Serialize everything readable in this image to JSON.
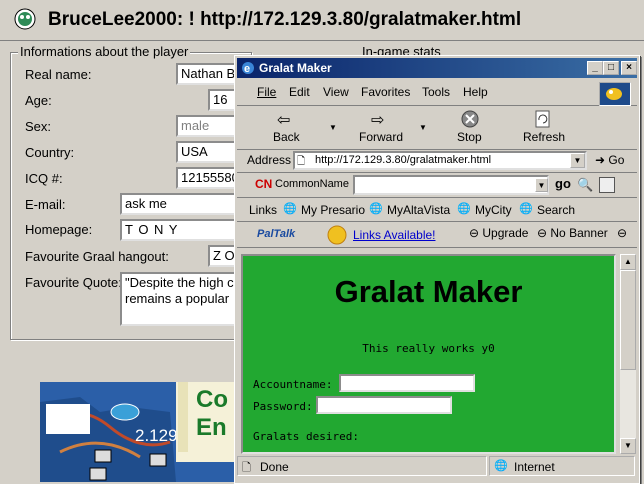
{
  "back_window": {
    "title": "BruceLee2000: ! http://172.129.3.80/gralatmaker.html",
    "group_title": "Informations about the player",
    "group2_title": "In-game stats",
    "fields": [
      {
        "label": "Real name:",
        "value": "Nathan B"
      },
      {
        "label": "Age:",
        "value": "16"
      },
      {
        "label": "Sex:",
        "value": "male"
      },
      {
        "label": "Country:",
        "value": "USA"
      },
      {
        "label": "ICQ #:",
        "value": "12155580"
      },
      {
        "label": "E-mail:",
        "value": "ask me"
      },
      {
        "label": "Homepage:",
        "value": "T O N Y"
      },
      {
        "label": "Favourite Graal hangout:",
        "value": "Z O"
      },
      {
        "label": "Favourite Quote:",
        "value": "\"Despite the high c\nremains a popular"
      }
    ],
    "map_overlay_text": "2.129",
    "ad_text": "Co\nEn"
  },
  "ie_window": {
    "title": "Gralat Maker",
    "menu": [
      "File",
      "Edit",
      "View",
      "Favorites",
      "Tools",
      "Help"
    ],
    "toolbar": {
      "back": "Back",
      "forward": "Forward",
      "stop": "Stop",
      "refresh": "Refresh"
    },
    "address_label": "Address",
    "address_url": "http://172.129.3.80/gralatmaker.html",
    "go_label": "Go",
    "cn_brand": "CN",
    "cn_field_label": "CommonName",
    "go_small": "go",
    "links_label": "Links",
    "links": [
      "My Presario",
      "MyAltaVista",
      "MyCity",
      "Search"
    ],
    "paltalk_label": "PalTalk",
    "links_available": "Links Available!",
    "upgrade_label": "Upgrade",
    "no_banner_label": "No Banner",
    "page": {
      "heading": "Gralat Maker",
      "subtitle": "This really works y0",
      "account_label": "Accountname:",
      "password_label": "Password:",
      "gralats_label": "Gralats desired:"
    },
    "status": {
      "left": "Done",
      "zone": "Internet"
    }
  },
  "colors": {
    "title_bar": "#0a246a",
    "page_bg": "#22a831",
    "window": "#d4d0c8"
  }
}
